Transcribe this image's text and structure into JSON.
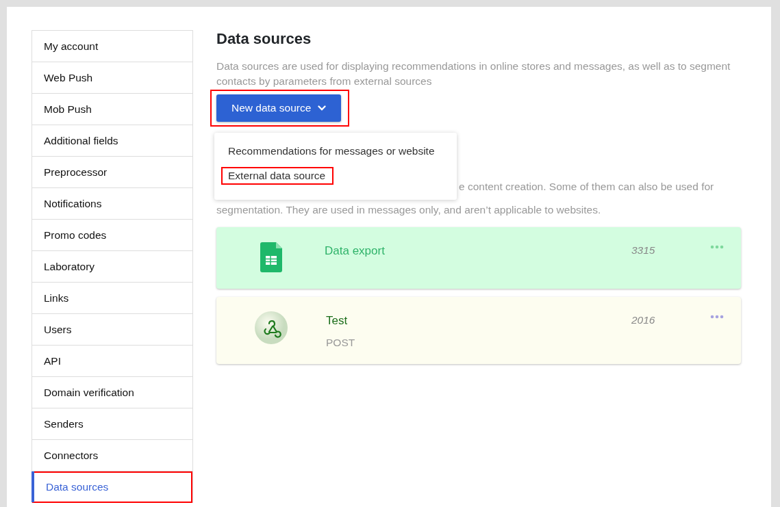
{
  "sidebar": {
    "items": [
      {
        "label": "My account",
        "selected": false,
        "highlighted": false
      },
      {
        "label": "Web Push",
        "selected": false,
        "highlighted": false
      },
      {
        "label": "Mob Push",
        "selected": false,
        "highlighted": false
      },
      {
        "label": "Additional fields",
        "selected": false,
        "highlighted": false
      },
      {
        "label": "Preprocessor",
        "selected": false,
        "highlighted": false
      },
      {
        "label": "Notifications",
        "selected": false,
        "highlighted": false
      },
      {
        "label": "Promo codes",
        "selected": false,
        "highlighted": false
      },
      {
        "label": "Laboratory",
        "selected": false,
        "highlighted": false
      },
      {
        "label": "Links",
        "selected": false,
        "highlighted": false
      },
      {
        "label": "Users",
        "selected": false,
        "highlighted": false
      },
      {
        "label": "API",
        "selected": false,
        "highlighted": false
      },
      {
        "label": "Domain verification",
        "selected": false,
        "highlighted": false
      },
      {
        "label": "Senders",
        "selected": false,
        "highlighted": false
      },
      {
        "label": "Connectors",
        "selected": false,
        "highlighted": false
      },
      {
        "label": "Data sources",
        "selected": true,
        "highlighted": true
      }
    ]
  },
  "main": {
    "title": "Data sources",
    "description": "Data sources are used for displaying recommendations in online stores and messages, as well as to segment contacts by parameters from external sources",
    "new_button": {
      "label": "New data source",
      "highlighted": true
    },
    "dropdown": {
      "items": [
        {
          "label": "Recommendations for messages or website",
          "highlighted": false
        },
        {
          "label": "External data source",
          "highlighted": true
        }
      ]
    },
    "hidden_text_lines": [
      "e content creation. Some of them can also be used for",
      "segmentation. They are used in messages only, and aren’t applicable to websites."
    ],
    "sources": [
      {
        "kind": "sheet",
        "name": "Data export",
        "count": "3315",
        "color": "#d3fde0"
      },
      {
        "kind": "webhook",
        "name": "Test",
        "method": "POST",
        "count": "2016",
        "color": "#fdfdf0"
      }
    ]
  }
}
